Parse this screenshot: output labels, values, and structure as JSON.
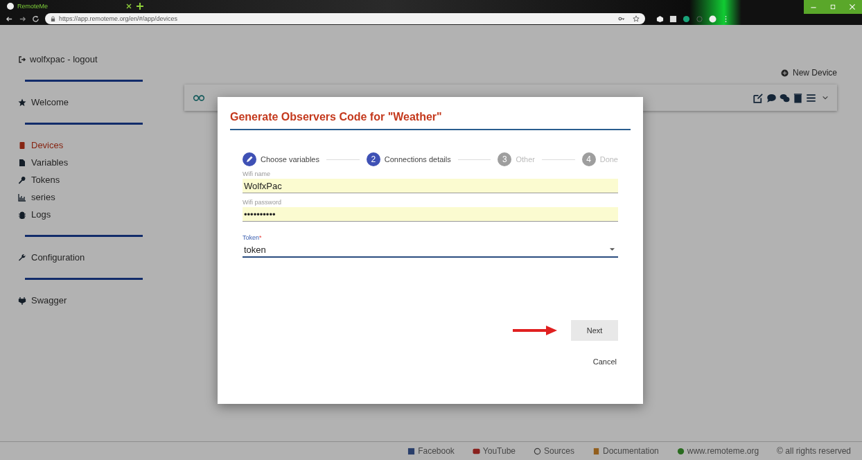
{
  "browser": {
    "tab_title": "RemoteMe",
    "url": "https://app.remoteme.org/en/#/app/devices"
  },
  "sidebar": {
    "user": "wolfxpac - logout",
    "groups": [
      {
        "items": [
          {
            "label": "Welcome",
            "selected": false
          }
        ]
      },
      {
        "items": [
          {
            "label": "Devices",
            "selected": true
          },
          {
            "label": "Variables",
            "selected": false
          },
          {
            "label": "Tokens",
            "selected": false
          },
          {
            "label": "series",
            "selected": false
          },
          {
            "label": "Logs",
            "selected": false
          }
        ]
      },
      {
        "items": [
          {
            "label": "Configuration",
            "selected": false
          }
        ]
      },
      {
        "items": [
          {
            "label": "Swagger",
            "selected": false
          }
        ]
      }
    ]
  },
  "new_device": "New Device",
  "dialog": {
    "title": "Generate Observers Code for \"Weather\"",
    "steps": [
      {
        "label": "Choose variables",
        "kind": "done"
      },
      {
        "number": "2",
        "label": "Connections details",
        "kind": "active"
      },
      {
        "number": "3",
        "label": "Other",
        "kind": "pending"
      },
      {
        "number": "4",
        "label": "Done",
        "kind": "pending"
      }
    ],
    "fields": [
      {
        "label": "Wifi name",
        "value": "WolfxPac",
        "kind": "text"
      },
      {
        "label": "Wifi password",
        "value": "••••••••••",
        "kind": "text"
      },
      {
        "label": "Token",
        "required": "*",
        "value": "token",
        "kind": "select"
      }
    ],
    "next": "Next",
    "cancel": "Cancel"
  },
  "footer": [
    {
      "label": "Facebook"
    },
    {
      "label": "YouTube"
    },
    {
      "label": "Sources"
    },
    {
      "label": "Documentation"
    },
    {
      "label": "www.remoteme.org"
    },
    {
      "label": "© all rights reserved"
    }
  ]
}
